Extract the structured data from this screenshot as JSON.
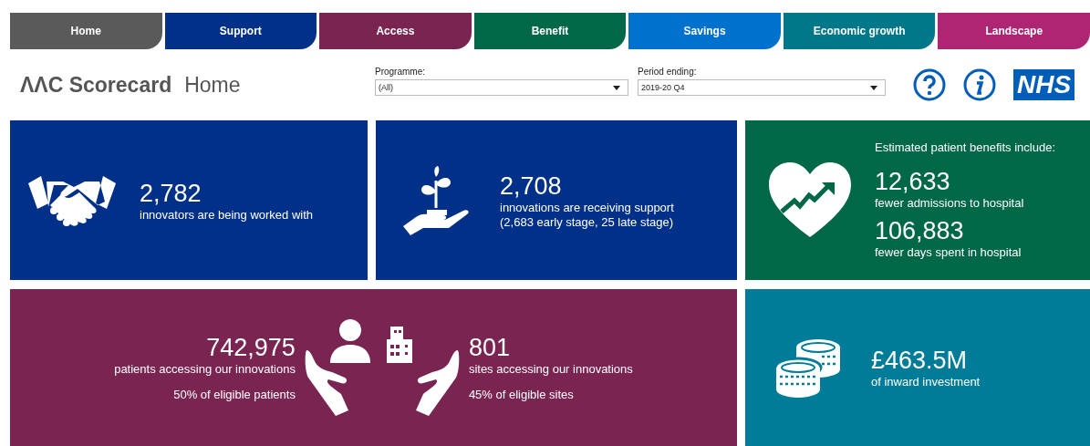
{
  "tabs": [
    {
      "label": "Home",
      "color": "#5a5a5a"
    },
    {
      "label": "Support",
      "color": "#003087"
    },
    {
      "label": "Access",
      "color": "#7a2451"
    },
    {
      "label": "Benefit",
      "color": "#006747"
    },
    {
      "label": "Savings",
      "color": "#0072ce"
    },
    {
      "label": "Economic growth",
      "color": "#00788a"
    },
    {
      "label": "Landscape",
      "color": "#ae2573"
    }
  ],
  "header": {
    "logo": "ΛΛC Scorecard",
    "page": "Home",
    "logo_badge": "NHS"
  },
  "filters": [
    {
      "label": "Programme:",
      "value": "(All)"
    },
    {
      "label": "Period ending:",
      "value": "2019-20 Q4"
    }
  ],
  "cards": [
    {
      "kind": "innovators",
      "value": "2,782",
      "lines": [
        "innovators are being worked with"
      ]
    },
    {
      "kind": "innovations",
      "value": "2,708",
      "lines": [
        "innovations are receiving support",
        "(2,683 early stage, 25 late stage)"
      ]
    },
    {
      "kind": "benefits",
      "intro": "Estimated patient benefits include:",
      "stats": [
        {
          "value": "12,633",
          "text": "fewer admissions to hospital"
        },
        {
          "value": "106,883",
          "text": "fewer days spent in hospital"
        }
      ]
    },
    {
      "kind": "access",
      "left": {
        "value": "742,975",
        "text": "patients accessing our innovations",
        "share": "50% of eligible patients"
      },
      "right": {
        "value": "801",
        "text": "sites accessing our innovations",
        "share": "45% of eligible sites"
      }
    },
    {
      "kind": "investment",
      "value": "£463.5M",
      "lines": [
        "of inward investment"
      ]
    }
  ]
}
